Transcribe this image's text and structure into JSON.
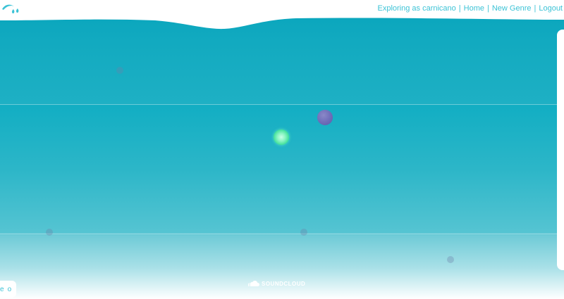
{
  "header": {
    "logo_icon": "raindrop-wave-logo",
    "nav": {
      "exploring_label": "Exploring as carnicano",
      "sep": "|",
      "home_label": "Home",
      "new_genre_label": "New Genre",
      "logout_label": "Logout"
    }
  },
  "footer": {
    "soundcloud_label": "SOUNDCLOUD",
    "soundcloud_icon": "soundcloud-cloud-icon"
  },
  "bottom_control": {
    "left_glyph": "e",
    "right_glyph": "o"
  },
  "colors": {
    "nav_text": "#3cc3d6",
    "ocean_top": "#06a4bc",
    "bubble_purple": "#6e6cb8",
    "bubble_green": "#40e09a"
  }
}
